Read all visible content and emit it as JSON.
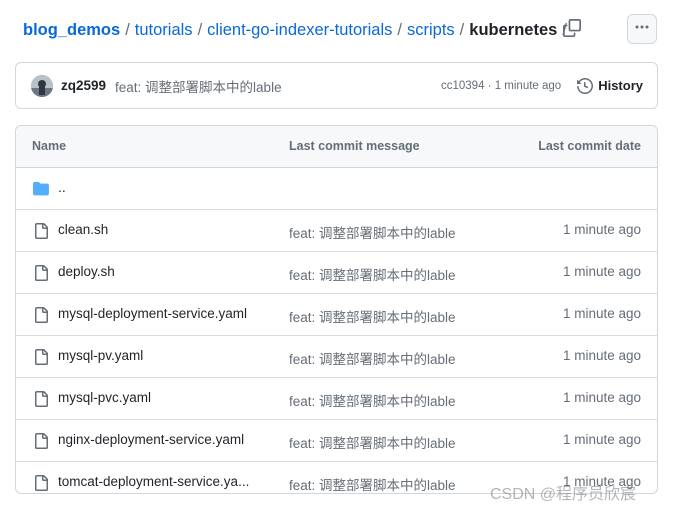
{
  "breadcrumb": {
    "repo": "blog_demos",
    "path": [
      "tutorials",
      "client-go-indexer-tutorials",
      "scripts"
    ],
    "current": "kubernetes",
    "trailing_sep": "/"
  },
  "commit": {
    "author": "zq2599",
    "message": "feat: 调整部署脚本中的lable",
    "sha_time": "cc10394 · 1 minute ago",
    "history_label": "History"
  },
  "table": {
    "headers": {
      "name": "Name",
      "message": "Last commit message",
      "date": "Last commit date"
    },
    "parent": "..",
    "files": [
      {
        "name": "clean.sh",
        "message": "feat: 调整部署脚本中的lable",
        "date": "1 minute ago"
      },
      {
        "name": "deploy.sh",
        "message": "feat: 调整部署脚本中的lable",
        "date": "1 minute ago"
      },
      {
        "name": "mysql-deployment-service.yaml",
        "message": "feat: 调整部署脚本中的lable",
        "date": "1 minute ago"
      },
      {
        "name": "mysql-pv.yaml",
        "message": "feat: 调整部署脚本中的lable",
        "date": "1 minute ago"
      },
      {
        "name": "mysql-pvc.yaml",
        "message": "feat: 调整部署脚本中的lable",
        "date": "1 minute ago"
      },
      {
        "name": "nginx-deployment-service.yaml",
        "message": "feat: 调整部署脚本中的lable",
        "date": "1 minute ago"
      },
      {
        "name": "tomcat-deployment-service.ya...",
        "message": "feat: 调整部署脚本中的lable",
        "date": "1 minute ago"
      }
    ]
  },
  "watermark": "CSDN @程序员欣宸",
  "colors": {
    "link": "#0969da",
    "folder": "#54aeff",
    "muted": "#656d76",
    "border": "#d0d7de"
  },
  "icons": {
    "copy": "copy-icon",
    "more": "kebab-horizontal-icon",
    "history": "history-icon",
    "folder": "folder-icon",
    "file": "file-icon"
  }
}
